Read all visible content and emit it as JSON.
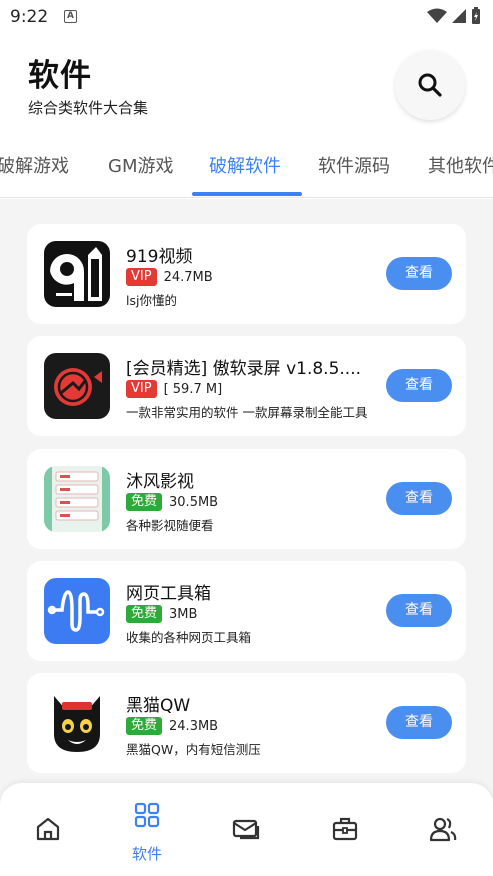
{
  "status_bar": {
    "time": "9:22",
    "icons": [
      "notification-a-icon",
      "wifi-icon",
      "signal-icon",
      "battery-icon"
    ]
  },
  "header": {
    "title": "软件",
    "subtitle": "综合类软件大合集",
    "search_icon": "search-icon"
  },
  "tabs": [
    {
      "label": "破解游戏",
      "active": false
    },
    {
      "label": "GM游戏",
      "active": false
    },
    {
      "label": "破解软件",
      "active": true
    },
    {
      "label": "软件源码",
      "active": false
    },
    {
      "label": "其他软件",
      "active": false
    }
  ],
  "apps": [
    {
      "name": "919视频",
      "badge": "VIP",
      "badge_type": "vip",
      "size": "24.7MB",
      "desc": "lsj你懂的",
      "button": "查看",
      "icon": "919-logo-icon"
    },
    {
      "name": "[会员精选] 傲软录屏 v1.8.5....",
      "badge": "VIP",
      "badge_type": "vip",
      "size": "[ 59.7 M]",
      "desc": "一款非常实用的软件 一款屏幕录制全能工具",
      "button": "查看",
      "icon": "screen-recorder-icon"
    },
    {
      "name": "沐风影视",
      "badge": "免费",
      "badge_type": "free",
      "size": "30.5MB",
      "desc": "各种影视随便看",
      "button": "查看",
      "icon": "video-app-icon"
    },
    {
      "name": "网页工具箱",
      "badge": "免费",
      "badge_type": "free",
      "size": "3MB",
      "desc": "收集的各种网页工具箱",
      "button": "查看",
      "icon": "toolbox-icon"
    },
    {
      "name": "黑猫QW",
      "badge": "免费",
      "badge_type": "free",
      "size": "24.3MB",
      "desc": "黑猫QW，内有短信测压",
      "button": "查看",
      "icon": "black-cat-icon"
    }
  ],
  "bottom_nav": [
    {
      "icon": "home-icon",
      "label": "",
      "active": false
    },
    {
      "icon": "grid-icon",
      "label": "软件",
      "active": true
    },
    {
      "icon": "mail-icon",
      "label": "",
      "active": false
    },
    {
      "icon": "toolbox-nav-icon",
      "label": "",
      "active": false
    },
    {
      "icon": "users-icon",
      "label": "",
      "active": false
    }
  ],
  "colors": {
    "accent": "#3b82f6",
    "vip": "#e53935",
    "free": "#2eaa3a",
    "button": "#4a8ff0",
    "background": "#f4f4f4"
  }
}
